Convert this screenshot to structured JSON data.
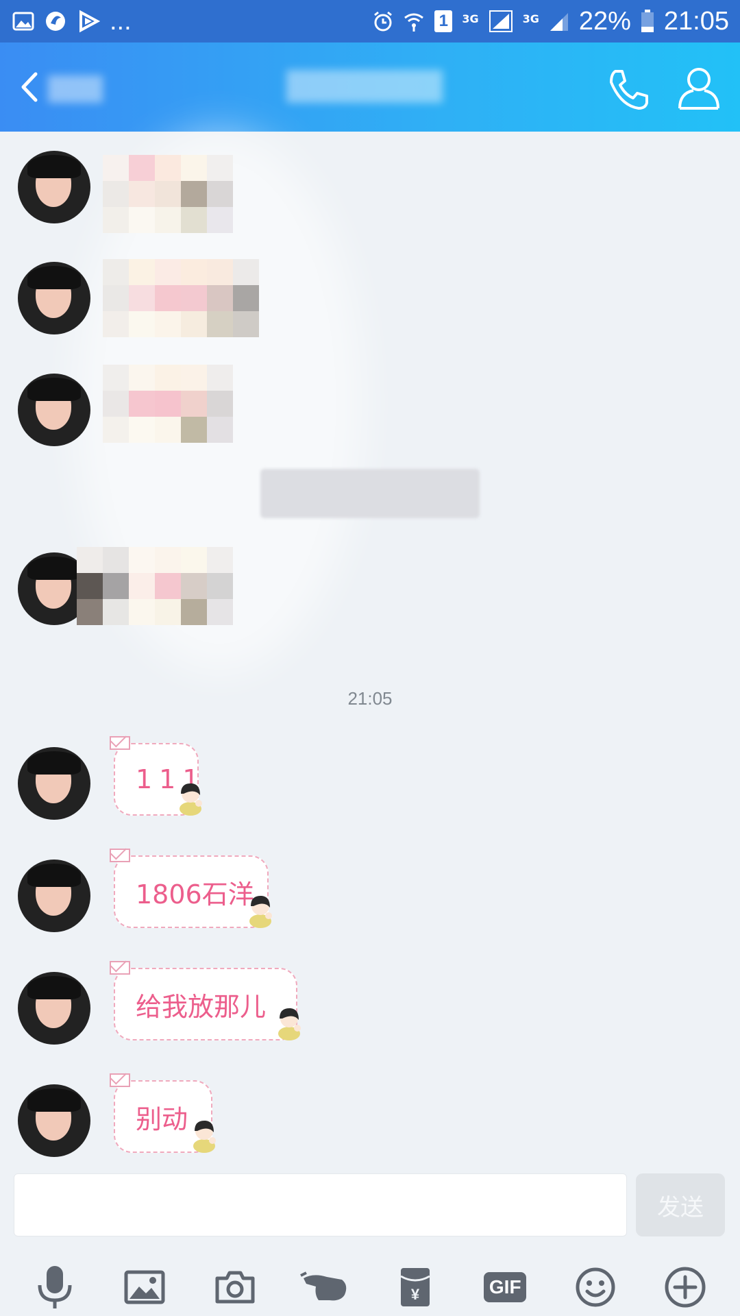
{
  "status_bar": {
    "more_notifications": "...",
    "sim_slot": "1",
    "network_1": "3G",
    "network_2": "3G",
    "battery": "22%",
    "time": "21:05",
    "left_icons": [
      "gallery-icon",
      "browser-icon",
      "play-icon"
    ],
    "right_icons": [
      "alarm-icon",
      "wifi-icon",
      "sim-icon",
      "signal-icon",
      "signal-icon",
      "battery-icon"
    ]
  },
  "header": {
    "contact_name": "",
    "icons": [
      "back-icon",
      "phone-icon",
      "profile-icon"
    ]
  },
  "chat": {
    "timestamp": "21:05",
    "messages": [
      {
        "text": "111"
      },
      {
        "text": "1806石洋"
      },
      {
        "text": "给我放那儿"
      },
      {
        "text": "别动"
      }
    ]
  },
  "composer": {
    "input_value": "",
    "send_label": "发送",
    "gif_label": "GIF",
    "tools": [
      "microphone-icon",
      "image-icon",
      "camera-icon",
      "poke-icon",
      "red-packet-icon",
      "gif-icon",
      "emoji-icon",
      "plus-icon"
    ]
  },
  "colors": {
    "header_start": "#3a8df3",
    "header_end": "#22c1f7",
    "bubble_text": "#ec5e8c",
    "bubble_border": "#f0a9bd",
    "background": "#eef2f6"
  }
}
